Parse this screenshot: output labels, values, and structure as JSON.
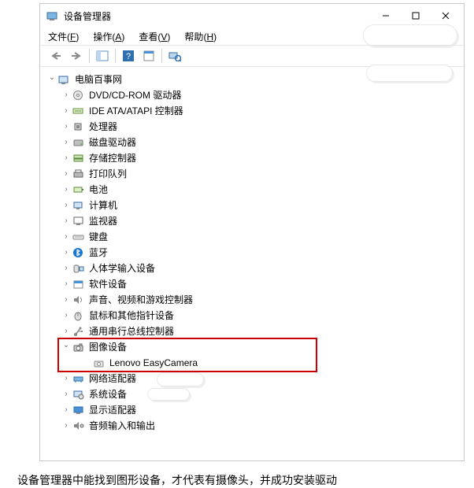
{
  "window": {
    "title": "设备管理器",
    "controls": {
      "min": "minimize",
      "max": "maximize",
      "close": "close"
    }
  },
  "menus": {
    "file": {
      "label": "文件",
      "accel": "F"
    },
    "action": {
      "label": "操作",
      "accel": "A"
    },
    "view": {
      "label": "查看",
      "accel": "V"
    },
    "help": {
      "label": "帮助",
      "accel": "H"
    }
  },
  "toolbar": {
    "back": "back",
    "forward": "forward",
    "show_hide": "show-hide-console-tree",
    "help": "help",
    "properties": "properties",
    "refresh": "scan-hardware-changes"
  },
  "tree": {
    "root": {
      "label": "电脑百事网",
      "expanded": true
    },
    "categories": [
      {
        "label": "DVD/CD-ROM 驱动器",
        "icon": "disc"
      },
      {
        "label": "IDE ATA/ATAPI 控制器",
        "icon": "ide"
      },
      {
        "label": "处理器",
        "icon": "cpu"
      },
      {
        "label": "磁盘驱动器",
        "icon": "disk"
      },
      {
        "label": "存储控制器",
        "icon": "storage"
      },
      {
        "label": "打印队列",
        "icon": "printer"
      },
      {
        "label": "电池",
        "icon": "battery"
      },
      {
        "label": "计算机",
        "icon": "computer"
      },
      {
        "label": "监视器",
        "icon": "monitor"
      },
      {
        "label": "键盘",
        "icon": "keyboard"
      },
      {
        "label": "蓝牙",
        "icon": "bluetooth"
      },
      {
        "label": "人体学输入设备",
        "icon": "hid"
      },
      {
        "label": "软件设备",
        "icon": "software"
      },
      {
        "label": "声音、视频和游戏控制器",
        "icon": "sound"
      },
      {
        "label": "鼠标和其他指针设备",
        "icon": "mouse"
      },
      {
        "label": "通用串行总线控制器",
        "icon": "usb"
      },
      {
        "label": "图像设备",
        "icon": "camera",
        "expanded": true,
        "children": [
          {
            "label": "Lenovo EasyCamera",
            "icon": "camera-item"
          }
        ]
      },
      {
        "label": "网络适配器",
        "icon": "network"
      },
      {
        "label": "系统设备",
        "icon": "system"
      },
      {
        "label": "显示适配器",
        "icon": "display"
      },
      {
        "label": "音频输入和输出",
        "icon": "audio"
      }
    ]
  },
  "highlight": {
    "target": "图像设备"
  },
  "caption": "设备管理器中能找到图形设备，才代表有摄像头，并成功安装驱动"
}
